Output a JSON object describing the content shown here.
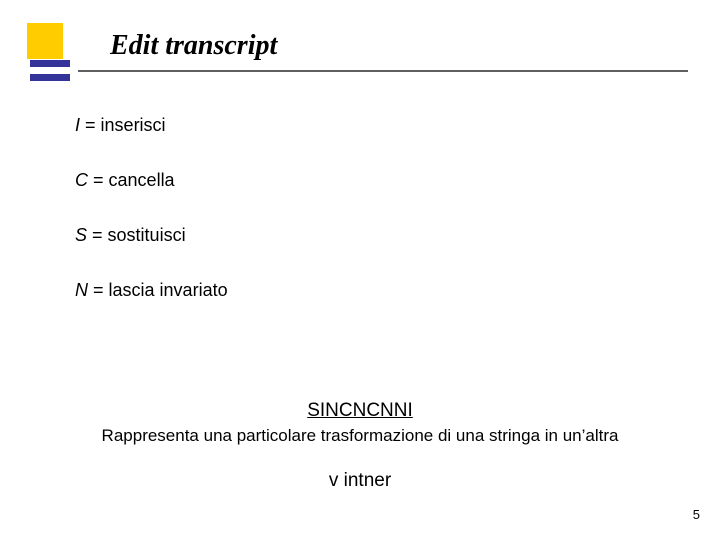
{
  "title": "Edit transcript",
  "definitions": [
    {
      "sym": "I",
      "text": "inserisci"
    },
    {
      "sym": "C",
      "text": "cancella"
    },
    {
      "sym": "S",
      "text": "sostituisci"
    },
    {
      "sym": "N",
      "text": "lascia invariato"
    }
  ],
  "sequence": "SINCNCNNI",
  "caption": "Rappresenta una particolare trasformazione di una stringa in un’altra",
  "example": "v intner",
  "page_number": "5"
}
